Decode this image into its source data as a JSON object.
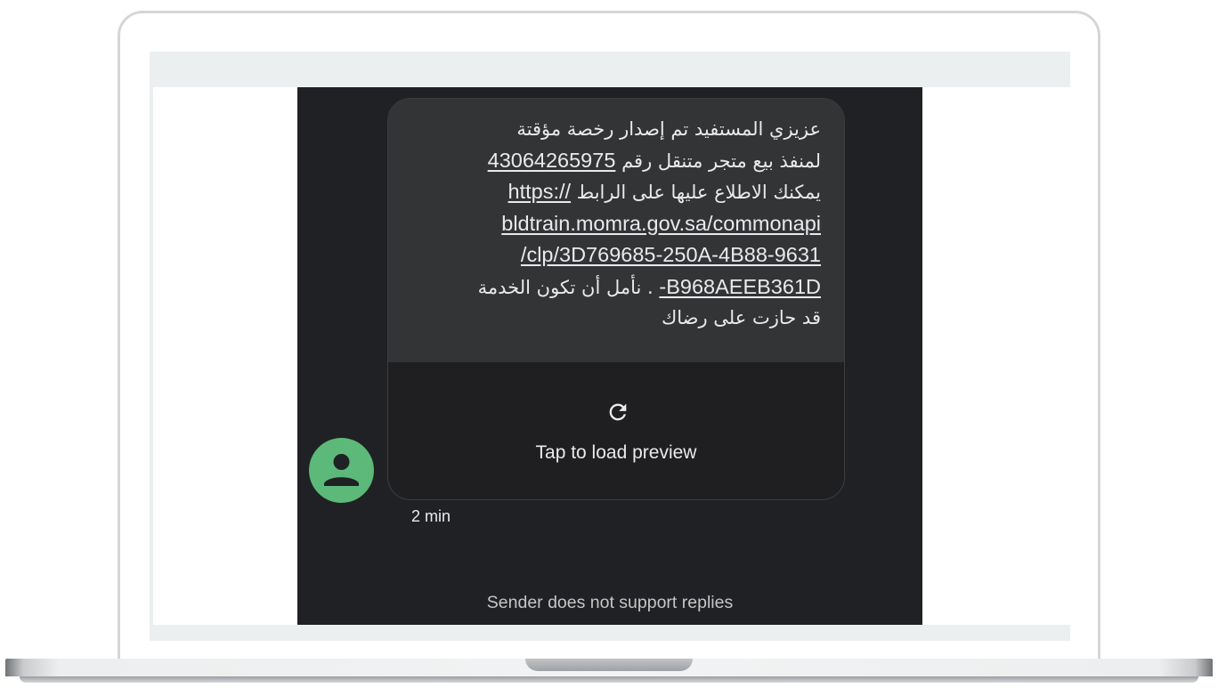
{
  "message": {
    "lines": [
      "عزيزي المستفيد تم إصدار رخصة مؤقتة",
      "لمنفذ بيع متجر متنقل رقم",
      "يمكنك الاطلاع عليها على الرابط",
      ". نأمل أن تكون الخدمة",
      "قد حازت على رضاك"
    ],
    "license_number": "43064265975",
    "link_parts": [
      "https://",
      "bldtrain.momra.gov.sa/commonapi",
      "/clp/3D769685-250A-4B88-9631",
      "-B968AEEB361D"
    ],
    "timestamp": "2 min"
  },
  "preview": {
    "label": "Tap to load preview",
    "icon": "refresh-icon"
  },
  "avatar": {
    "icon": "person-icon",
    "color": "#5cb979"
  },
  "footer": {
    "note": "Sender does not support replies"
  },
  "colors": {
    "background": "#202124",
    "bubble": "#333436",
    "text": "#e8eaed"
  }
}
